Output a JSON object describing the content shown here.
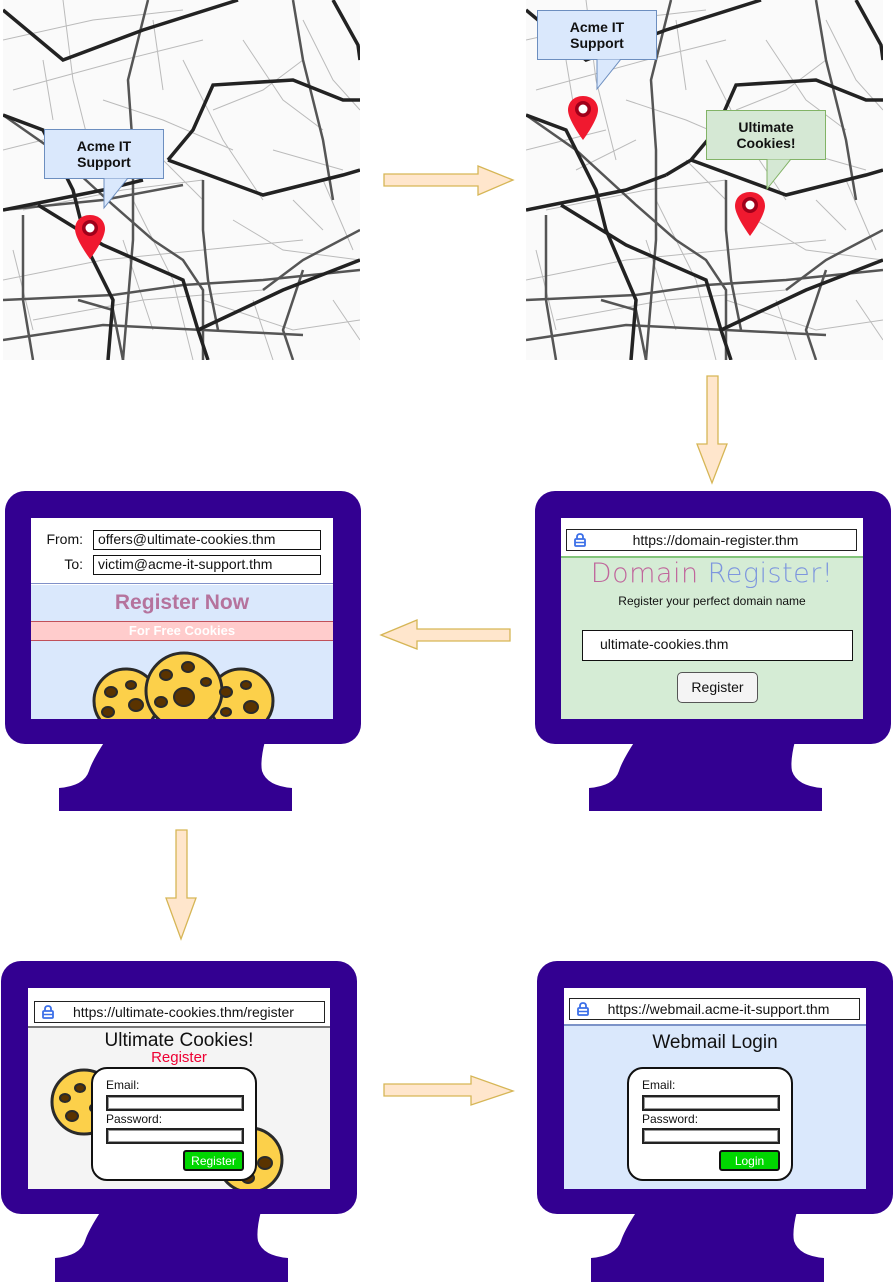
{
  "diagram_title": "Domain registration phishing workflow",
  "colors": {
    "monitor": "#330091",
    "arrow_fill": "#ffe6cc",
    "arrow_stroke": "#d6b656",
    "callout_blue": "#dae8fc",
    "callout_green": "#d5e8d4",
    "pin": "#f0192f",
    "register_now": "#b5739d",
    "free_cookies_band": "#ffcccc",
    "email_body_bg": "#dae8fc",
    "domain_site_bg": "#d5ecd5",
    "cookie_site_bg": "#f4f4f4",
    "webmail_bg": "#dae8fc",
    "green_button": "#00d700",
    "register_red": "#ee0033"
  },
  "step1_map": {
    "callouts": [
      {
        "label": "Acme IT Support",
        "line1": "Acme IT",
        "line2": "Support",
        "style": "blue"
      }
    ],
    "pins": [
      "acme-location-pin"
    ]
  },
  "step2_map": {
    "callouts": [
      {
        "label": "Acme IT Support",
        "line1": "Acme IT",
        "line2": "Support",
        "style": "blue"
      },
      {
        "label": "Ultimate Cookies!",
        "line1": "Ultimate",
        "line2": "Cookies!",
        "style": "green"
      }
    ],
    "pins": [
      "acme-location-pin",
      "ultimate-cookies-location-pin"
    ]
  },
  "step3_domain_register": {
    "url": "https://domain-register.thm",
    "title_part1": "Domain",
    "title_part2": "Register!",
    "subtitle": "Register your perfect domain name",
    "domain_input_value": "ultimate-cookies.thm",
    "button_label": "Register"
  },
  "step4_phishing_email": {
    "from_label": "From:",
    "from_value": "offers@ultimate-cookies.thm",
    "to_label": "To:",
    "to_value": "victim@acme-it-support.thm",
    "headline": "Register Now",
    "band_text": "For Free Cookies"
  },
  "step5_fake_register": {
    "url": "https://ultimate-cookies.thm/register",
    "site_title": "Ultimate Cookies!",
    "subtitle": "Register",
    "email_label": "Email:",
    "password_label": "Password:",
    "button_label": "Register"
  },
  "step6_webmail": {
    "url": "https://webmail.acme-it-support.thm",
    "title": "Webmail Login",
    "email_label": "Email:",
    "password_label": "Password:",
    "button_label": "Login"
  },
  "flow_arrows": [
    {
      "from": "step1_map",
      "to": "step2_map",
      "direction": "right"
    },
    {
      "from": "step2_map",
      "to": "step3_domain_register",
      "direction": "down"
    },
    {
      "from": "step3_domain_register",
      "to": "step4_phishing_email",
      "direction": "left"
    },
    {
      "from": "step4_phishing_email",
      "to": "step5_fake_register",
      "direction": "down"
    },
    {
      "from": "step5_fake_register",
      "to": "step6_webmail",
      "direction": "right"
    }
  ]
}
